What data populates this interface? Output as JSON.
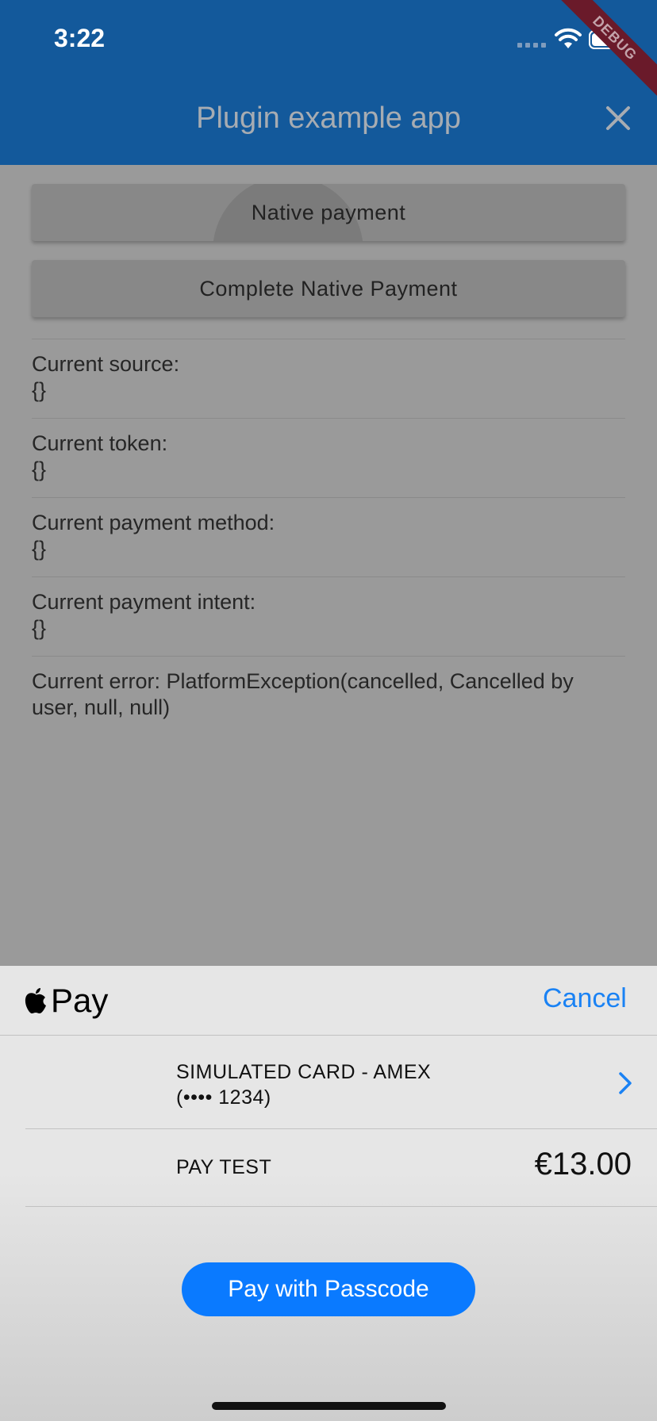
{
  "status_bar": {
    "time": "3:22"
  },
  "app_bar": {
    "title": "Plugin example app",
    "debug_banner": "DEBUG"
  },
  "buttons": {
    "native_payment": "Native payment",
    "complete_native_payment": "Complete Native Payment"
  },
  "info": {
    "source_label": "Current source:",
    "source_value": "{}",
    "token_label": "Current token:",
    "token_value": "{}",
    "payment_method_label": "Current payment method:",
    "payment_method_value": "{}",
    "payment_intent_label": "Current payment intent:",
    "payment_intent_value": "{}",
    "error_text": "Current error: PlatformException(cancelled, Cancelled by user, null, null)"
  },
  "apple_pay_sheet": {
    "logo_text": "Pay",
    "cancel_label": "Cancel",
    "card_line1": "SIMULATED CARD - AMEX",
    "card_line2": "(•••• 1234)",
    "pay_to": "PAY TEST",
    "amount": "€13.00",
    "pay_button": "Pay with Passcode"
  },
  "colors": {
    "app_bar": "#13599b",
    "accent": "#0a7aff",
    "cancel": "#1a82f4",
    "overlay": "#9a9a9a"
  },
  "icons": [
    "wifi-icon",
    "battery-icon",
    "close-icon",
    "apple-logo-icon",
    "chevron-right-icon"
  ]
}
